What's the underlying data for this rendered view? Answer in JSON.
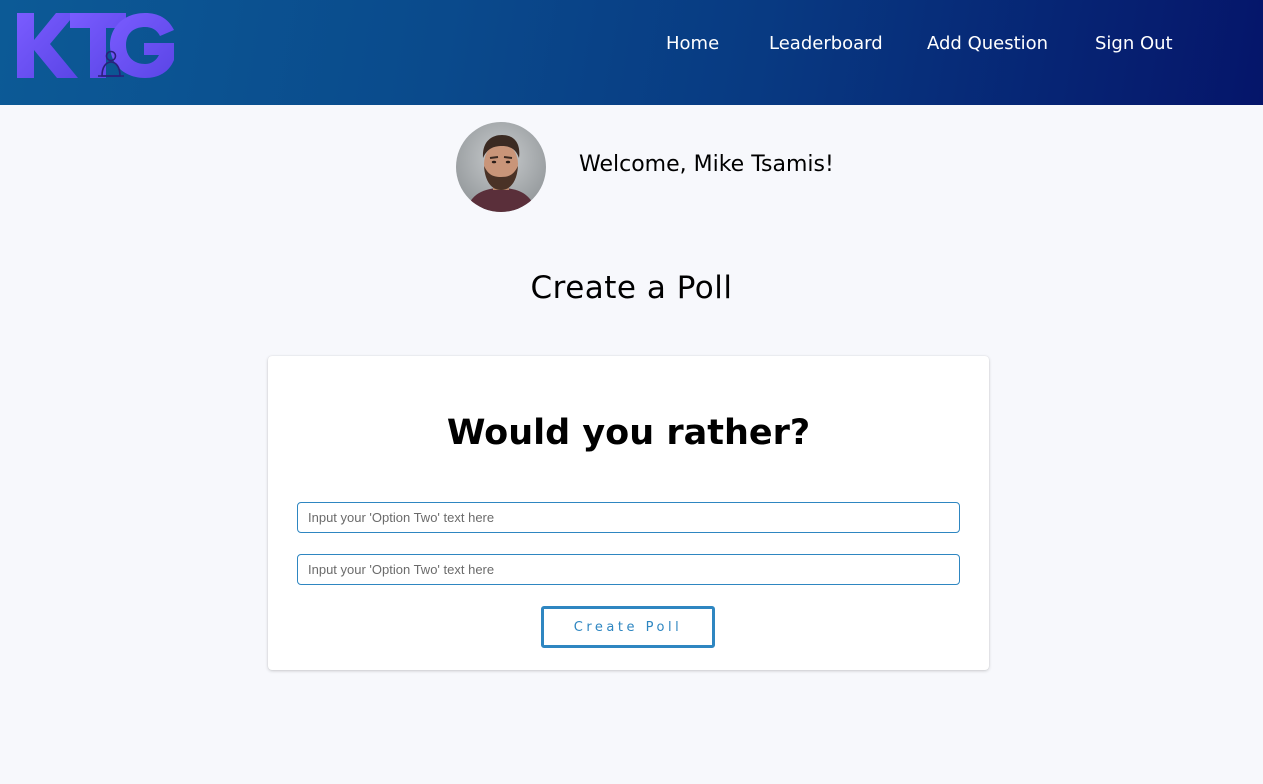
{
  "navbar": {
    "logo_text": "KTG",
    "links": [
      "Home",
      "Leaderboard",
      "Add Question",
      "Sign Out"
    ]
  },
  "user": {
    "welcome": "Welcome, Mike Tsamis!"
  },
  "page": {
    "title": "Create a Poll"
  },
  "poll_form": {
    "heading": "Would you rather?",
    "option_one_placeholder": "Input your 'Option Two' text here",
    "option_two_placeholder": "Input your 'Option Two' text here",
    "option_one_value": "",
    "option_two_value": "",
    "submit_label": "Create Poll"
  },
  "colors": {
    "accent": "#2e86c1",
    "logo_purple": "#6a4ff5",
    "nav_gradient_start": "#0c5a96",
    "nav_gradient_end": "#05156a",
    "page_background": "#f7f8fc"
  }
}
